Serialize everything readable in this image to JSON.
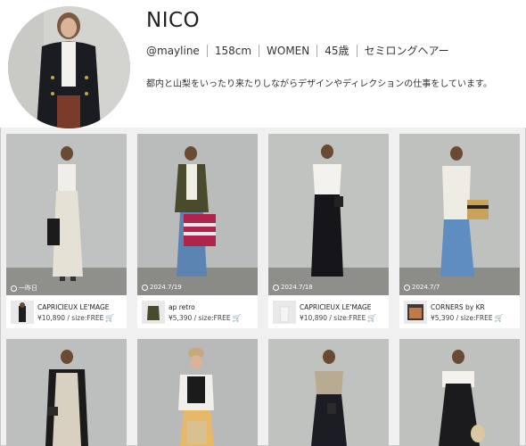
{
  "profile": {
    "name": "NICO",
    "handle": "@mayline",
    "height": "158cm",
    "gender": "WOMEN",
    "age": "45歳",
    "hair": "セミロングヘアー",
    "bio": "都内と山梨をいったり来たりしながらデザインやディレクションの仕事をしています。"
  },
  "posts": [
    {
      "date": "一昨日",
      "brand": "CAPRICIEUX LE'MAGE",
      "price": "¥10,890 / size:FREE"
    },
    {
      "date": "2024.7/19",
      "brand": "ap retro",
      "price": "¥5,390 / size:FREE"
    },
    {
      "date": "2024.7/18",
      "brand": "CAPRICIEUX LE'MAGE",
      "price": "¥10,890 / size:FREE"
    },
    {
      "date": "2024.7/7",
      "brand": "CORNERS by KR",
      "price": "¥5,390 / size:FREE"
    }
  ],
  "icons": {
    "clock": "clock-icon",
    "cart": "cart-icon"
  }
}
